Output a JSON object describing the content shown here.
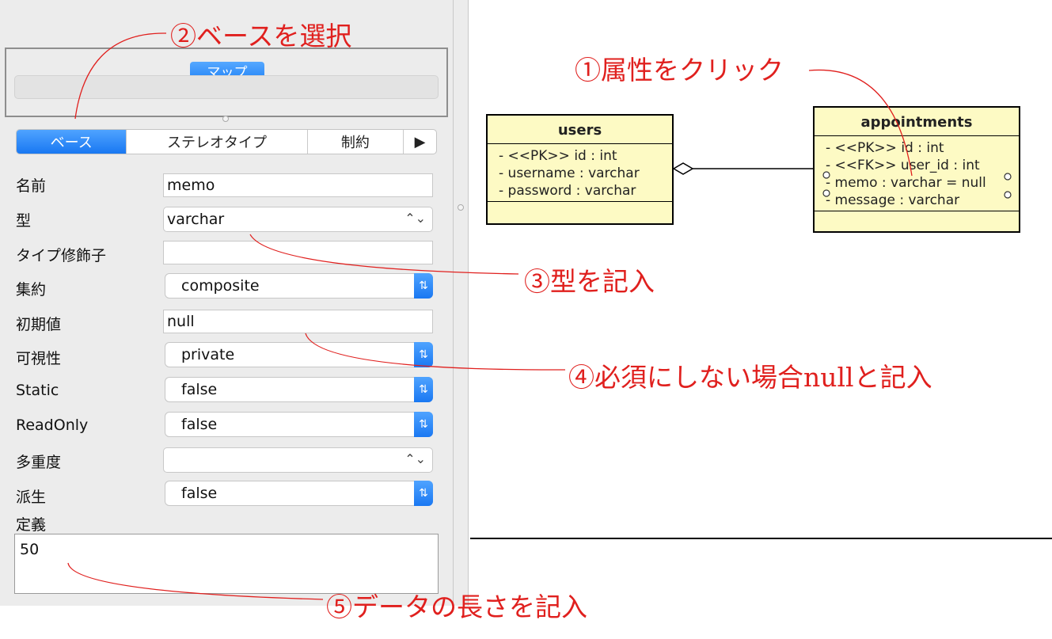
{
  "top": {
    "map_button": "マップ"
  },
  "tabs": [
    {
      "label": "ベース",
      "active": true
    },
    {
      "label": "ステレオタイプ",
      "active": false
    },
    {
      "label": "制約",
      "active": false
    },
    {
      "label": "▶",
      "active": false
    }
  ],
  "props": {
    "name": {
      "label": "名前",
      "value": "memo"
    },
    "type": {
      "label": "型",
      "value": "varchar"
    },
    "type_modifier": {
      "label": "タイプ修飾子",
      "value": ""
    },
    "aggregation": {
      "label": "集約",
      "value": "composite"
    },
    "initial": {
      "label": "初期値",
      "value": "null"
    },
    "visibility": {
      "label": "可視性",
      "value": "private"
    },
    "static": {
      "label": "Static",
      "value": "false"
    },
    "readonly": {
      "label": "ReadOnly",
      "value": "false"
    },
    "multiplicity": {
      "label": "多重度",
      "value": ""
    },
    "derived": {
      "label": "派生",
      "value": "false"
    },
    "definition": {
      "label": "定義",
      "value": "50"
    }
  },
  "diagram": {
    "users": {
      "name": "users",
      "attrs": [
        "- <<PK>> id : int",
        "- username : varchar",
        "- password : varchar"
      ]
    },
    "appointments": {
      "name": "appointments",
      "attrs": [
        "- <<PK>> id : int",
        "- <<FK>> user_id : int",
        "- memo : varchar = null",
        "- message : varchar"
      ]
    }
  },
  "annotations": {
    "a1": "①属性をクリック",
    "a2": "②ベースを選択",
    "a3": "③型を記入",
    "a4_pre": "④必須にしない場合",
    "a4_null": "null",
    "a4_post": "と記入",
    "a5": "⑤データの長さを記入"
  },
  "colors": {
    "annotation": "#e0201e",
    "accent": "#1a7ef5",
    "class_fill": "#fdfac4"
  }
}
